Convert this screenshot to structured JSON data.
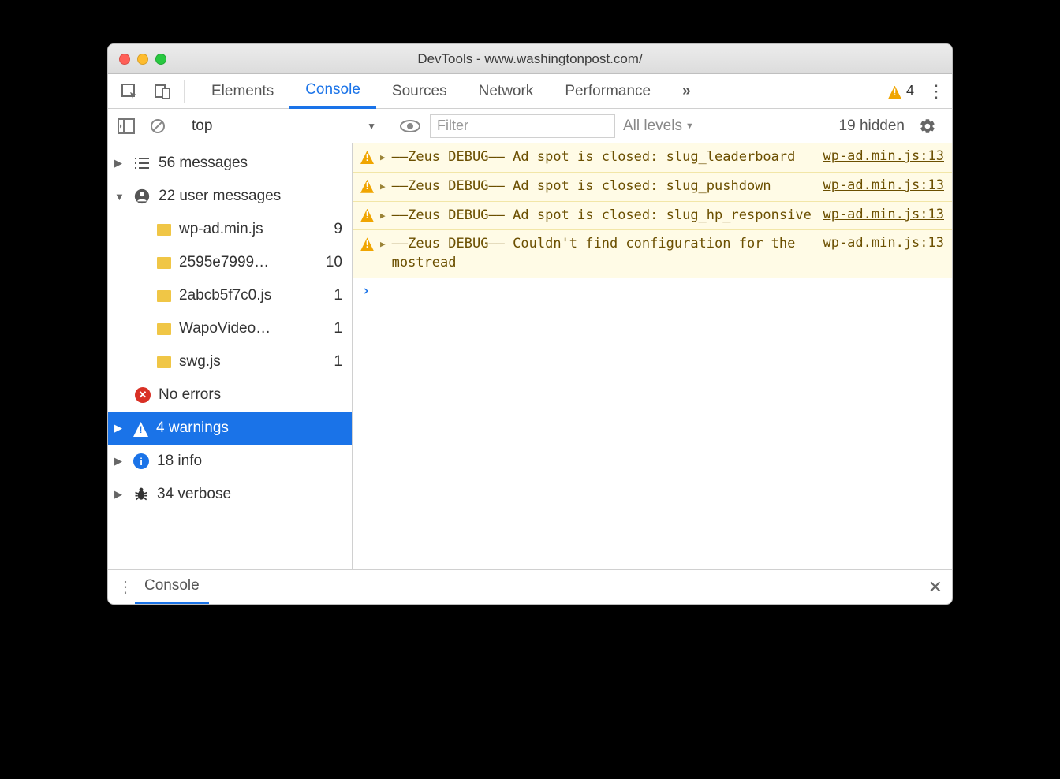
{
  "window": {
    "title": "DevTools - www.washingtonpost.com/"
  },
  "tabs": {
    "elements": "Elements",
    "console": "Console",
    "sources": "Sources",
    "network": "Network",
    "performance": "Performance"
  },
  "warn_badge": "4",
  "toolbar": {
    "context": "top",
    "filter_placeholder": "Filter",
    "levels": "All levels",
    "hidden": "19 hidden"
  },
  "sidebar": {
    "messages": "56 messages",
    "user_messages": "22 user messages",
    "files": [
      {
        "name": "wp-ad.min.js",
        "count": "9"
      },
      {
        "name": "2595e7999…",
        "count": "10"
      },
      {
        "name": "2abcb5f7c0.js",
        "count": "1"
      },
      {
        "name": "WapoVideo…",
        "count": "1"
      },
      {
        "name": "swg.js",
        "count": "1"
      }
    ],
    "no_errors": "No errors",
    "warnings": "4 warnings",
    "info": "18 info",
    "verbose": "34 verbose"
  },
  "logs": [
    {
      "text": "––Zeus DEBUG–– Ad spot is closed: slug_leaderboard",
      "src": "wp-ad.min.js:13"
    },
    {
      "text": "––Zeus DEBUG–– Ad spot is closed: slug_pushdown",
      "src": "wp-ad.min.js:13"
    },
    {
      "text": "––Zeus DEBUG–– Ad spot is closed: slug_hp_responsive",
      "src": "wp-ad.min.js:13"
    },
    {
      "text": "––Zeus DEBUG–– Couldn't find configuration for the mostread",
      "src": "wp-ad.min.js:13"
    }
  ],
  "drawer": {
    "tab": "Console"
  }
}
